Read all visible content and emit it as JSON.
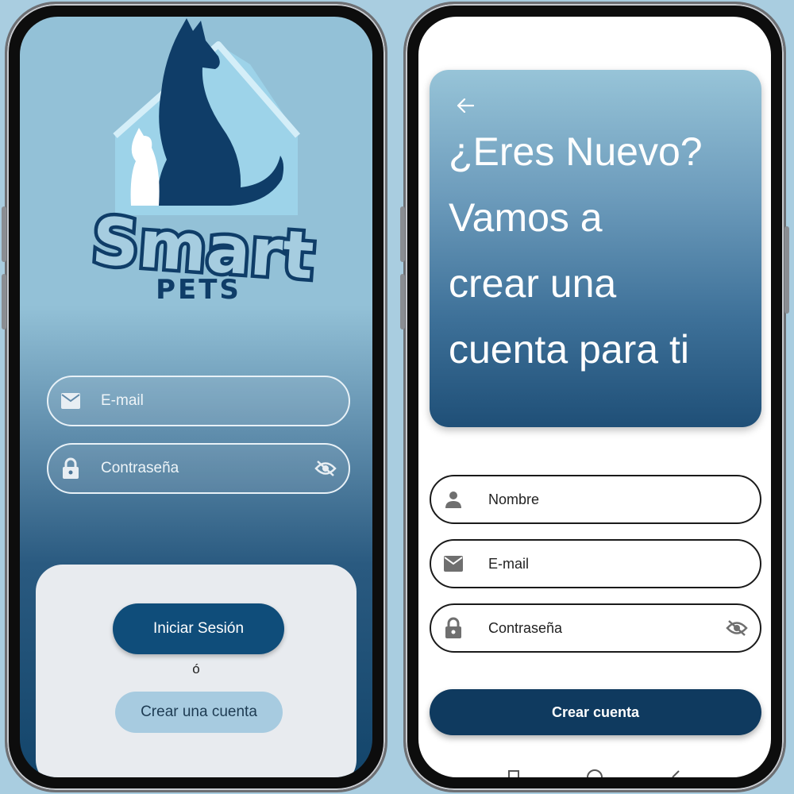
{
  "login_screen": {
    "logo": {
      "brand_word": "Smart",
      "brand_sub": "PETS",
      "icon": "dog-and-cat-logo-icon"
    },
    "email_field": {
      "placeholder": "E-mail",
      "icon": "mail-icon"
    },
    "password_field": {
      "placeholder": "Contraseña",
      "icon": "lock-icon",
      "toggle_icon": "eye-off-icon"
    },
    "login_button": "Iniciar Sesión",
    "or_text": "ó",
    "create_account_button": "Crear una cuenta"
  },
  "register_screen": {
    "back_icon": "arrow-back-icon",
    "title_lines": [
      "¿Eres Nuevo?",
      "Vamos a",
      "crear una",
      "cuenta para ti"
    ],
    "name_field": {
      "placeholder": "Nombre",
      "icon": "person-icon"
    },
    "email_field": {
      "placeholder": "E-mail",
      "icon": "mail-icon"
    },
    "password_field": {
      "placeholder": "Contraseña",
      "icon": "lock-icon",
      "toggle_icon": "eye-off-icon"
    },
    "create_button": "Crear cuenta"
  },
  "colors": {
    "background": "#a9cde0",
    "primary_dark": "#0f4d7a",
    "primary_button": "#0f3a5f",
    "secondary_button": "#a7cbe0",
    "card_light": "#e8ebef"
  }
}
